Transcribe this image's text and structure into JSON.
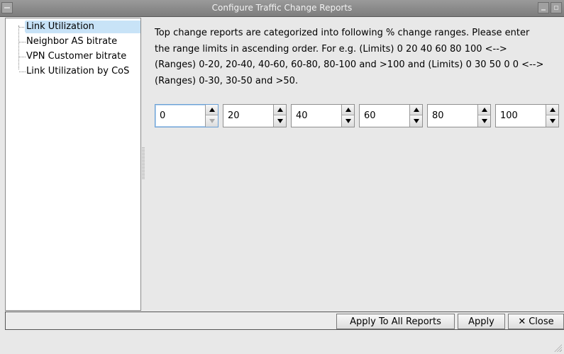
{
  "window": {
    "title": "Configure Traffic Change Reports"
  },
  "tree": {
    "items": [
      {
        "label": "Link Utilization",
        "selected": true
      },
      {
        "label": "Neighbor AS bitrate",
        "selected": false
      },
      {
        "label": "VPN Customer bitrate",
        "selected": false
      },
      {
        "label": "Link Utilization by CoS",
        "selected": false
      }
    ]
  },
  "content": {
    "description_lines": [
      "Top change reports are categorized into following % change ranges.  Please enter",
      "the range limits in ascending order.  For e.g. (Limits) 0 20 40 60 80 100 <-->",
      "(Ranges) 0-20, 20-40, 40-60, 60-80, 80-100 and >100 and (Limits) 0 30 50 0 0 <-->",
      "(Ranges) 0-30, 30-50 and >50."
    ],
    "limits": [
      "0",
      "20",
      "40",
      "60",
      "80",
      "100"
    ]
  },
  "buttons": {
    "apply_all": "Apply To All Reports",
    "apply": "Apply",
    "close": "Close",
    "close_icon": "✕"
  }
}
